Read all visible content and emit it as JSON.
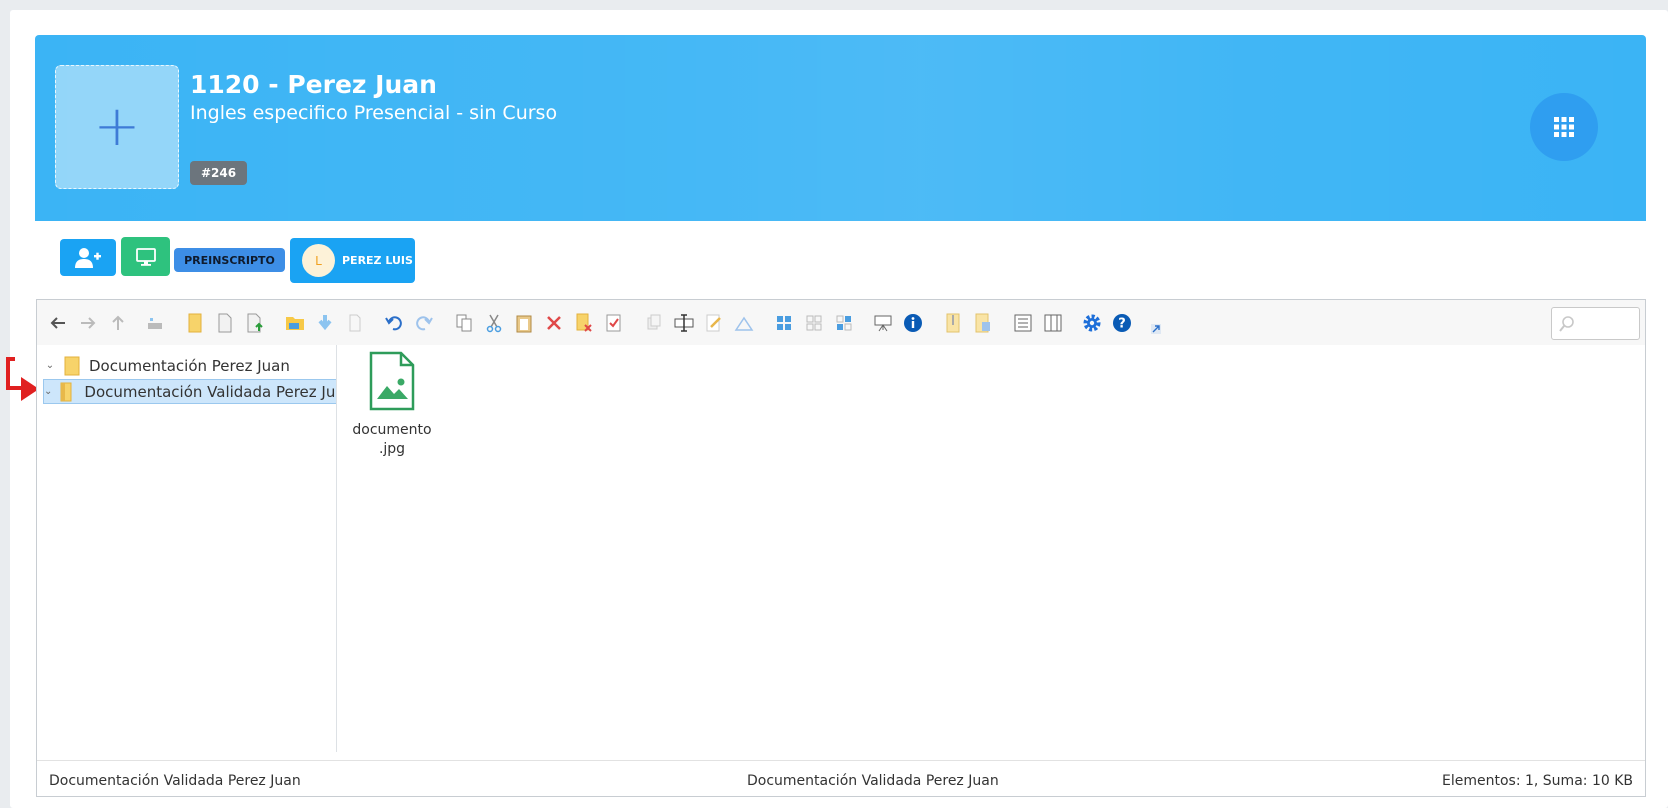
{
  "header": {
    "title": "1120 - Perez Juan",
    "subtitle": "Ingles especifico Presencial - sin Curso",
    "id_badge": "#246",
    "avatar_plus": "+",
    "background_color": "#3bb4f5"
  },
  "actions": {
    "status": "PREINSCRIPTO",
    "user_initial": "L",
    "user_name": "PEREZ LUIS"
  },
  "file_manager": {
    "toolbar_icons": [
      "arrow-left-icon",
      "arrow-right-icon",
      "arrow-up-icon",
      "reload-icon",
      "new-folder-icon",
      "new-file-icon",
      "upload-icon",
      "open-folder-icon",
      "download-icon",
      "get-file-icon",
      "undo-icon",
      "redo-icon",
      "copy-icon",
      "cut-icon",
      "paste-icon",
      "delete-icon",
      "empty-icon",
      "select-all-icon",
      "duplicate-icon",
      "rename-icon",
      "edit-icon",
      "resize-icon",
      "view-icons-icon",
      "select-none-icon",
      "invert-selection-icon",
      "preview-icon",
      "info-icon",
      "archive-icon",
      "extract-icon",
      "list-view-icon",
      "columns-icon",
      "settings-icon",
      "help-icon",
      "fullscreen-icon"
    ],
    "search_placeholder": "",
    "tree": [
      {
        "label": "Documentación Perez Juan",
        "selected": false
      },
      {
        "label": "Documentación Validada Perez Juan",
        "selected": true
      }
    ],
    "files": [
      {
        "name_line1": "documento",
        "name_line2": ".jpg"
      }
    ],
    "status": {
      "left": "Documentación Validada Perez Juan",
      "center": "Documentación Validada Perez Juan",
      "right": "Elementos: 1, Suma: 10 KB"
    }
  }
}
